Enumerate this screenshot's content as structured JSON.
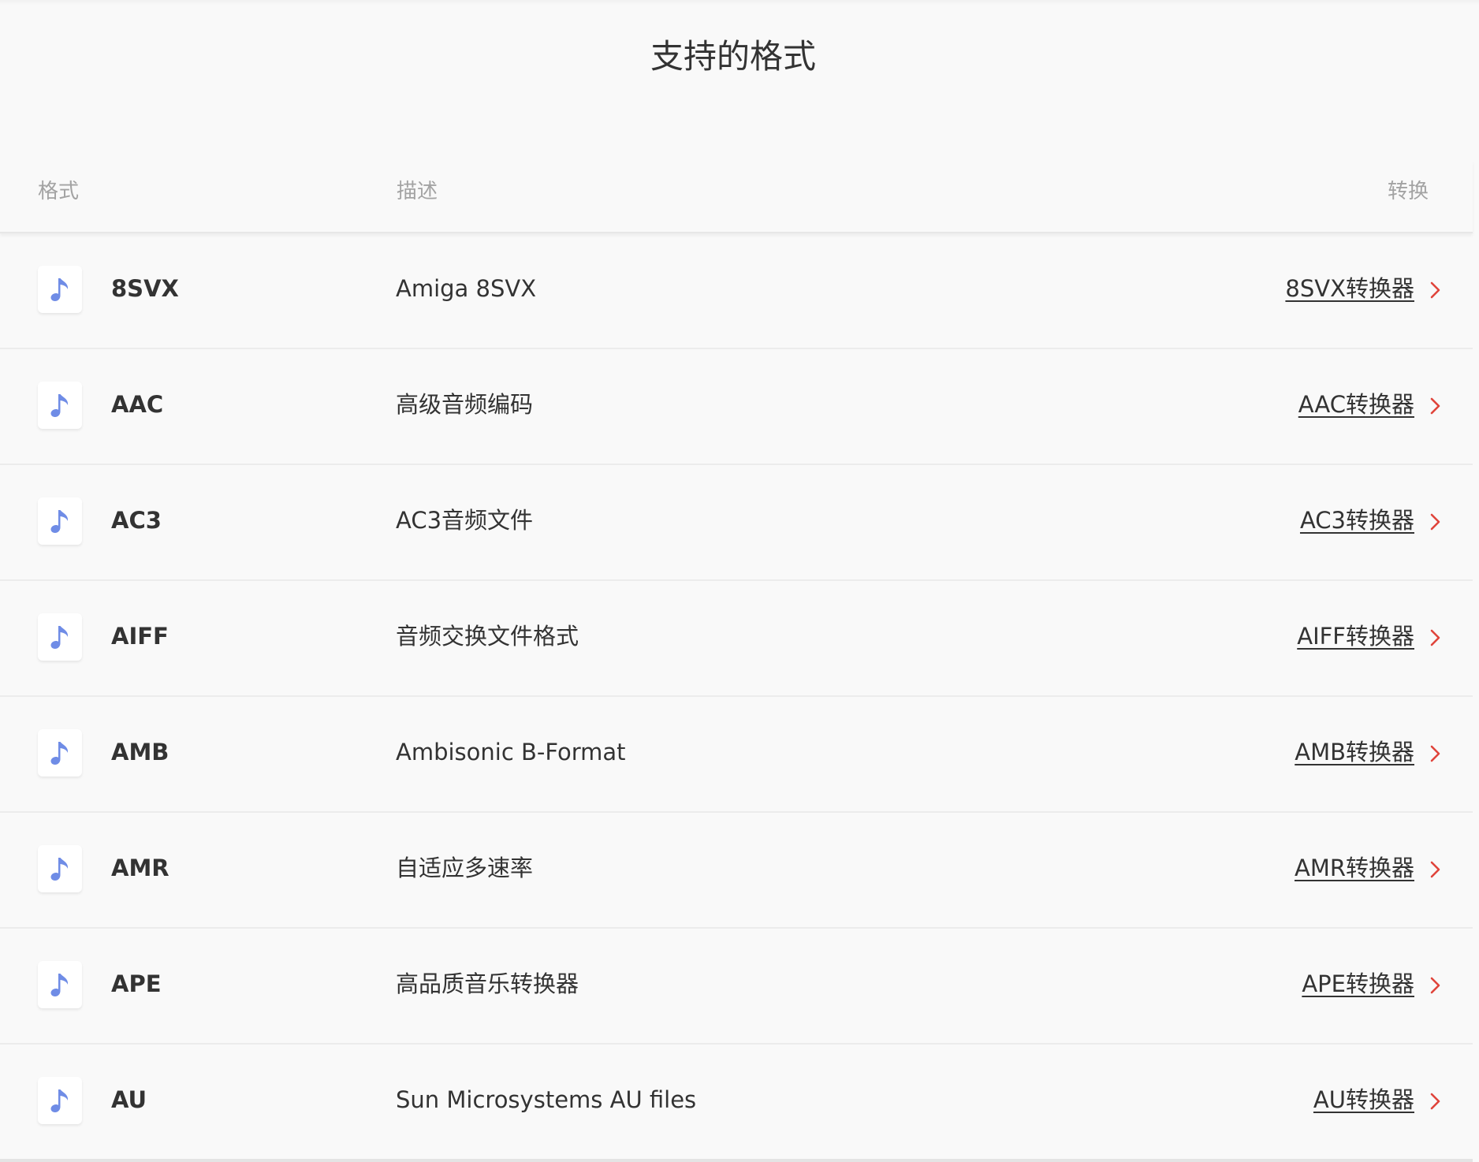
{
  "page": {
    "title": "支持的格式"
  },
  "table": {
    "headers": {
      "format": "格式",
      "description": "描述",
      "convert": "转换"
    },
    "rows": [
      {
        "format": "8SVX",
        "description": "Amiga 8SVX",
        "link": "8SVX转换器"
      },
      {
        "format": "AAC",
        "description": "高级音频编码",
        "link": "AAC转换器"
      },
      {
        "format": "AC3",
        "description": "AC3音频文件",
        "link": "AC3转换器"
      },
      {
        "format": "AIFF",
        "description": "音频交换文件格式",
        "link": "AIFF转换器"
      },
      {
        "format": "AMB",
        "description": "Ambisonic B-Format",
        "link": "AMB转换器"
      },
      {
        "format": "AMR",
        "description": "自适应多速率",
        "link": "AMR转换器"
      },
      {
        "format": "APE",
        "description": "高品质音乐转换器",
        "link": "APE转换器"
      },
      {
        "format": "AU",
        "description": "Sun Microsystems AU files",
        "link": "AU转换器"
      }
    ]
  },
  "icons": {
    "row_icon": "music-note-icon",
    "link_arrow": "chevron-right-icon"
  },
  "colors": {
    "icon": "#6f8ce6",
    "chevron": "#e0443b",
    "text": "#333333",
    "header_text": "#a3a3a3",
    "background": "#f9f9f9"
  }
}
